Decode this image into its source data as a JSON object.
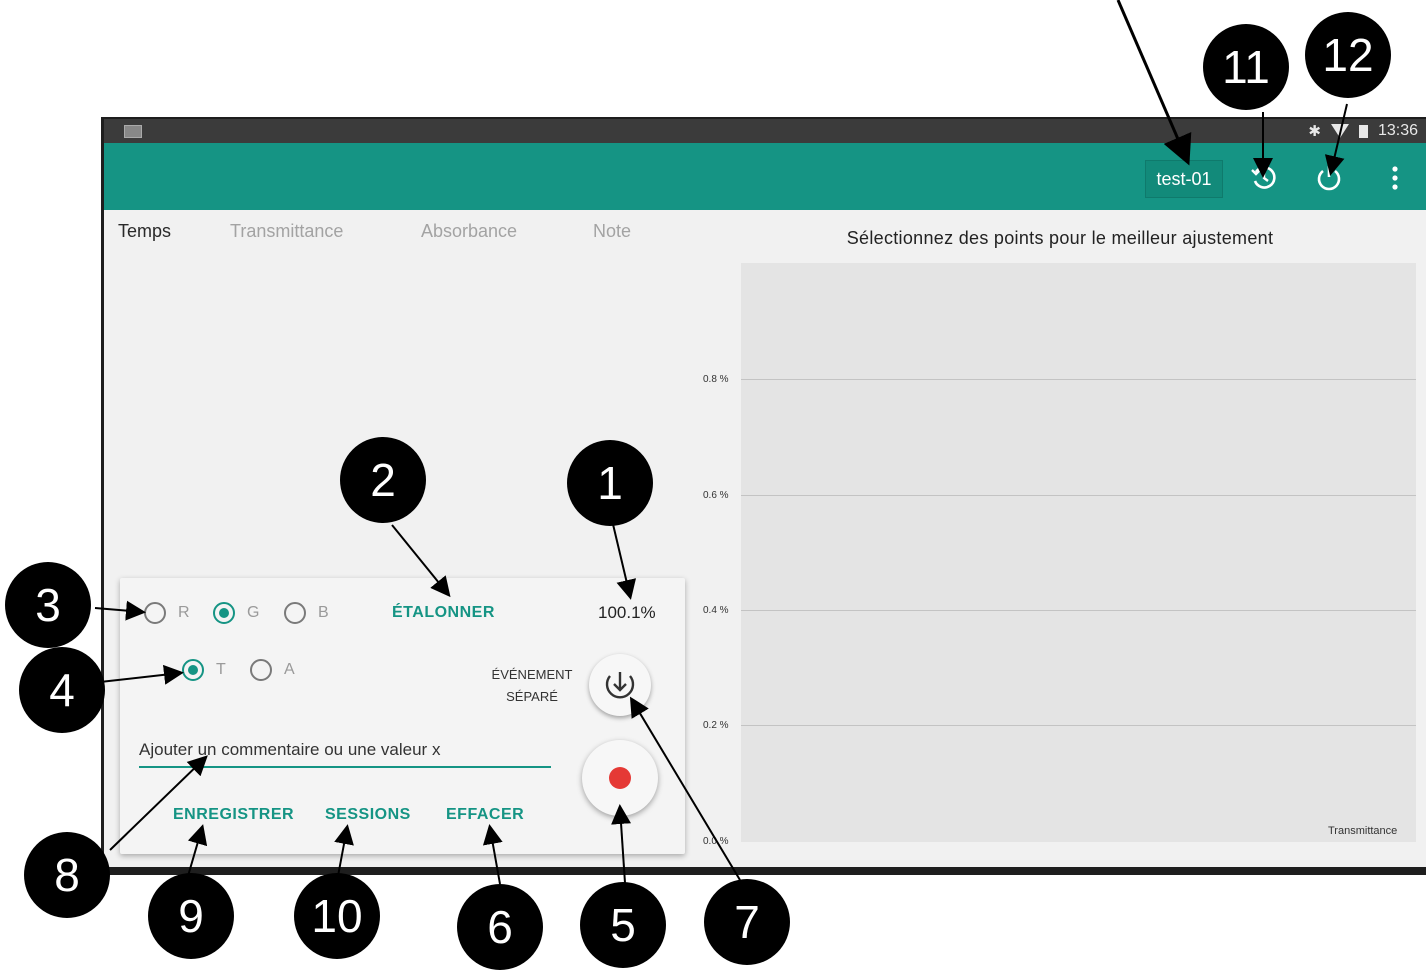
{
  "status_bar": {
    "time": "13:36",
    "icons": [
      "image-icon",
      "bluetooth-icon",
      "wifi-icon",
      "battery-icon"
    ]
  },
  "app_bar": {
    "file_name": "test-01",
    "icons": [
      "history-icon",
      "power-icon",
      "more-vert-icon"
    ],
    "color": "#159484"
  },
  "table": {
    "columns": [
      "Temps",
      "Transmittance",
      "Absorbance",
      "Note"
    ]
  },
  "chart": {
    "title": "Sélectionnez des points pour le meilleur ajustement",
    "y_ticks": [
      "0.8 %",
      "0.6 %",
      "0.4 %",
      "0.2 %",
      "0.0 %"
    ],
    "x_label": "Transmittance"
  },
  "controls": {
    "channels": [
      {
        "label": "R",
        "checked": false
      },
      {
        "label": "G",
        "checked": true
      },
      {
        "label": "B",
        "checked": false
      }
    ],
    "modes": [
      {
        "label": "T",
        "checked": true
      },
      {
        "label": "A",
        "checked": false
      }
    ],
    "calibrate_label": "ÉTALONNER",
    "reading": "100.1%",
    "event_label_line1": "ÉVÉNEMENT",
    "event_label_line2": "SÉPARÉ",
    "comment_placeholder": "Ajouter un commentaire ou une valeur x",
    "save_label": "ENREGISTRER",
    "sessions_label": "SESSIONS",
    "clear_label": "EFFACER",
    "record_color": "#e53935"
  },
  "callouts": [
    "1",
    "2",
    "3",
    "4",
    "5",
    "6",
    "7",
    "8",
    "9",
    "10",
    "11",
    "12"
  ]
}
